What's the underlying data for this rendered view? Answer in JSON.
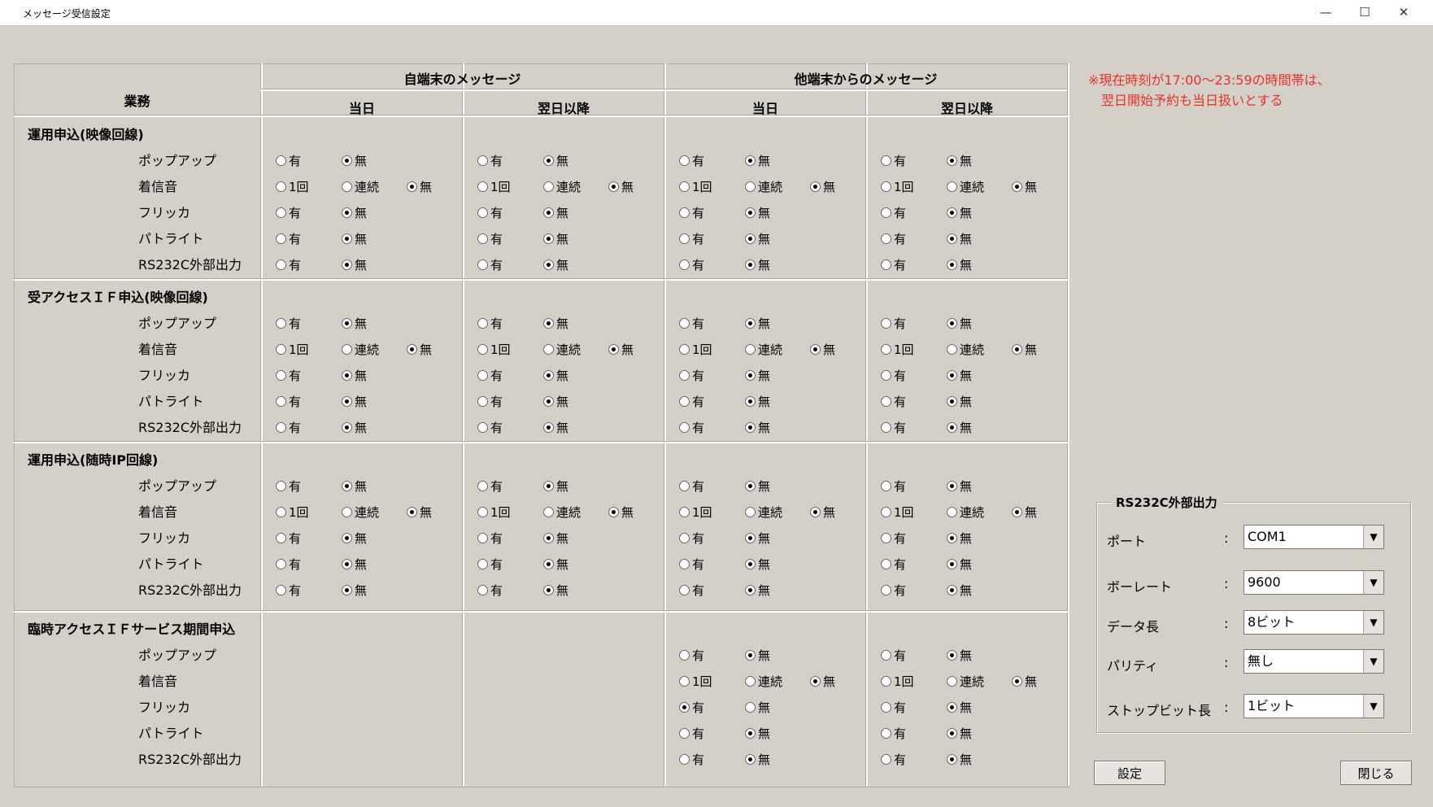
{
  "window": {
    "title": "メッセージ受信設定",
    "min": "—",
    "max": "☐",
    "close": "✕"
  },
  "headers": {
    "task": "業務",
    "self": "自端末のメッセージ",
    "other": "他端末からのメッセージ",
    "today": "当日",
    "next": "翌日以降"
  },
  "opts": {
    "yes": "有",
    "no": "無",
    "once": "1回",
    "cont": "連続"
  },
  "sections": [
    {
      "name": "運用申込(映像回線)",
      "items": [
        "ポップアップ",
        "着信音",
        "フリッカ",
        "パトライト",
        "RS232C外部出力"
      ]
    },
    {
      "name": "受アクセスＩＦ申込(映像回線)",
      "items": [
        "ポップアップ",
        "着信音",
        "フリッカ",
        "パトライト",
        "RS232C外部出力"
      ]
    },
    {
      "name": "運用申込(随時IP回線)",
      "items": [
        "ポップアップ",
        "着信音",
        "フリッカ",
        "パトライト",
        "RS232C外部出力"
      ]
    },
    {
      "name": "臨時アクセスＩＦサービス期間申込",
      "items": [
        "ポップアップ",
        "着信音",
        "フリッカ",
        "パトライト",
        "RS232C外部出力"
      ]
    }
  ],
  "selections": [
    [
      [
        "no",
        "no",
        "no",
        "no"
      ],
      [
        "no",
        "no",
        "no",
        "no"
      ],
      [
        "no",
        "no",
        "no",
        "no"
      ],
      [
        "no",
        "no",
        "no",
        "no"
      ],
      [
        "no",
        "no",
        "no",
        "no"
      ]
    ],
    [
      [
        "no",
        "no",
        "no",
        "no"
      ],
      [
        "no",
        "no",
        "no",
        "no"
      ],
      [
        "no",
        "no",
        "no",
        "no"
      ],
      [
        "no",
        "no",
        "no",
        "no"
      ],
      [
        "no",
        "no",
        "no",
        "no"
      ]
    ],
    [
      [
        "no",
        "no",
        "no",
        "no"
      ],
      [
        "no",
        "no",
        "no",
        "no"
      ],
      [
        "no",
        "no",
        "no",
        "no"
      ],
      [
        "no",
        "no",
        "no",
        "no"
      ],
      [
        "no",
        "no",
        "no",
        "no"
      ]
    ],
    [
      [
        null,
        null,
        "no",
        "no"
      ],
      [
        null,
        null,
        "no",
        "no"
      ],
      [
        null,
        null,
        "yes",
        "no"
      ],
      [
        null,
        null,
        "no",
        "no"
      ],
      [
        null,
        null,
        "no",
        "no"
      ]
    ]
  ],
  "note": [
    "※現在時刻が17:00～23:59の時間帯は、",
    "翌日開始予約も当日扱いとする"
  ],
  "rs232c": {
    "title": "RS232C外部出力",
    "fields": [
      {
        "label": "ポート",
        "value": "COM1"
      },
      {
        "label": "ボーレート",
        "value": "9600"
      },
      {
        "label": "データ長",
        "value": "8ビット"
      },
      {
        "label": "パリティ",
        "value": "無し"
      },
      {
        "label": "ストップビット長",
        "value": "1ビット"
      }
    ],
    "colon": ":"
  },
  "buttons": {
    "set": "設定",
    "close": "閉じる"
  }
}
